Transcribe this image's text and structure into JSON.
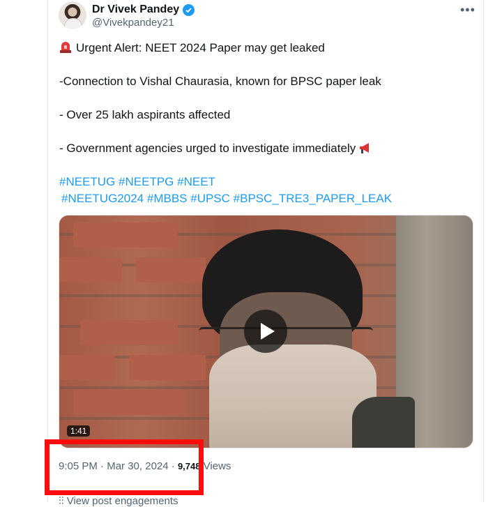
{
  "author": {
    "display_name": "Dr Vivek Pandey",
    "handle": "@Vivekpandey21",
    "verified": true
  },
  "tweet": {
    "lines": [
      "Urgent Alert: NEET 2024 Paper may get leaked",
      "-Connection to Vishal Chaurasia, known for BPSC paper leak",
      "- Over 25 lakh aspirants affected",
      "- Government agencies urged to investigate immediately"
    ],
    "hashtags_row1": [
      "#NEETUG",
      "#NEETPG",
      "#NEET"
    ],
    "hashtags_row2": [
      "#NEETUG2024",
      "#MBBS",
      "#UPSC",
      "#BPSC_TRE3_PAPER_LEAK"
    ]
  },
  "media": {
    "duration": "1:41"
  },
  "meta": {
    "time": "9:05 PM",
    "date": "Mar 30, 2024",
    "views_count": "9,748",
    "views_label": "Views",
    "separator": "·"
  },
  "engagements_label": "View post engagements",
  "colors": {
    "link": "#1d9bf0",
    "highlight_box": "#ff0d0d",
    "text": "#0f1419",
    "secondary": "#536471"
  }
}
